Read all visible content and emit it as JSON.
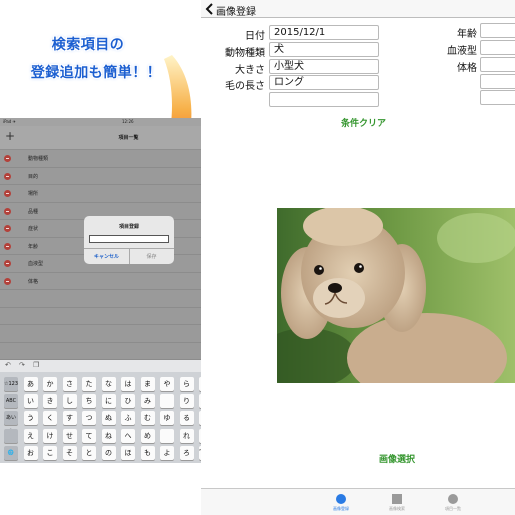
{
  "promo": {
    "line1": "検索項目の",
    "line2": "登録追加も簡単！！"
  },
  "ipad": {
    "status_left": "iPad ✈",
    "status_time": "12:26",
    "status_right": "48%",
    "nav_title": "項目一覧",
    "nav_done": "完了",
    "rows": [
      "動物種類",
      "目的",
      "場所",
      "品種",
      "症状",
      "年齢",
      "血液型",
      "体格"
    ],
    "dialog": {
      "title": "項目登録",
      "cancel": "キャンセル",
      "save": "保存"
    },
    "keyboard": {
      "rows": [
        [
          "☆123",
          "あ",
          "か",
          "さ",
          "た",
          "な",
          "は",
          "ま",
          "や",
          "ら",
          "わ",
          "「」",
          "⌫"
        ],
        [
          "ABC",
          "い",
          "き",
          "し",
          "ち",
          "に",
          "ひ",
          "み",
          "",
          "り",
          "を",
          "!",
          "空白"
        ],
        [
          "あいう",
          "う",
          "く",
          "す",
          "つ",
          "ぬ",
          "ふ",
          "む",
          "ゆ",
          "る",
          "ん",
          "?",
          ""
        ],
        [
          "",
          "え",
          "け",
          "せ",
          "て",
          "ね",
          "へ",
          "め",
          "",
          "れ",
          "ー",
          ".",
          "改行"
        ],
        [
          "🌐",
          "お",
          "こ",
          "そ",
          "と",
          "の",
          "ほ",
          "も",
          "よ",
          "ろ",
          "゛゜",
          "、",
          ""
        ]
      ]
    }
  },
  "app": {
    "nav_title": "画像登録",
    "fields": [
      {
        "label": "日付",
        "value": "2015/12/1"
      },
      {
        "label": "動物種類",
        "value": "犬"
      },
      {
        "label": "大きさ",
        "value": "小型犬"
      },
      {
        "label": "毛の長さ",
        "value": "ロング"
      },
      {
        "label": "",
        "value": ""
      }
    ],
    "right_fields": [
      {
        "label": "年齢",
        "value": ""
      },
      {
        "label": "血液型",
        "value": ""
      },
      {
        "label": "体格",
        "value": ""
      },
      {
        "label": "",
        "value": ""
      },
      {
        "label": "",
        "value": ""
      }
    ],
    "clear_label": "条件クリア",
    "select_label": "画像選択",
    "tabs": [
      {
        "label": "画像登録",
        "icon": "circle-icon",
        "active": true
      },
      {
        "label": "画像検索",
        "icon": "square-icon",
        "active": false
      },
      {
        "label": "項目一覧",
        "icon": "circle-icon",
        "active": false
      }
    ],
    "colors": {
      "accent": "#2a7be4",
      "green": "#35962f",
      "promo_blue": "#1c5fd1",
      "arrow": "#f08a1e"
    }
  }
}
